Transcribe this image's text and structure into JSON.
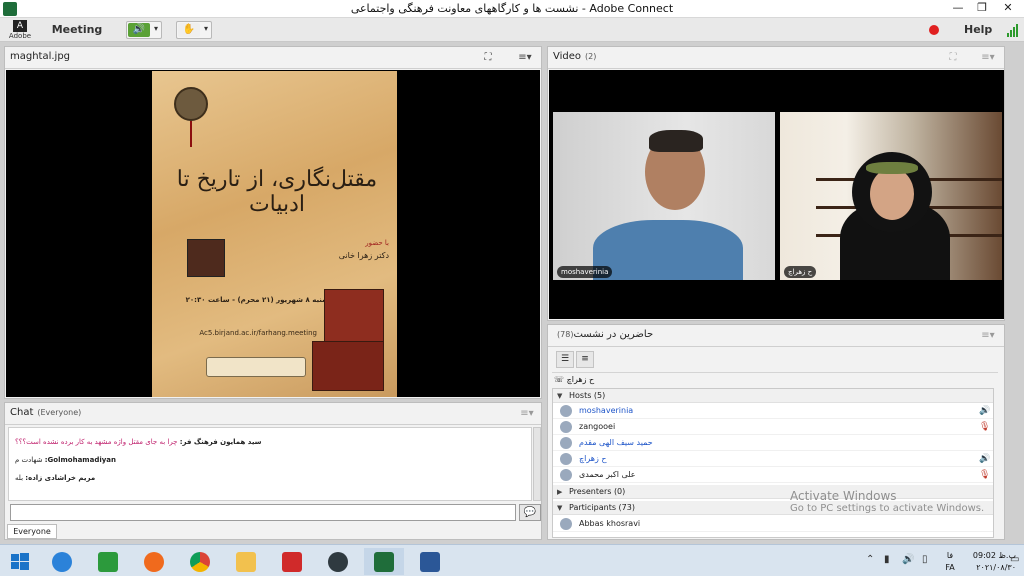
{
  "window": {
    "title": "نشست ها و کارگاههای معاونت فرهنگی واجتماعی - Adobe Connect",
    "minimize_glyph": "—",
    "restore_glyph": "❐",
    "close_glyph": "✕"
  },
  "menubar": {
    "adobe_label": "Adobe",
    "meeting_label": "Meeting",
    "help_label": "Help",
    "speaker_glyph": "🔊",
    "camera_glyph": "✋",
    "dropdown_glyph": "▾"
  },
  "share_pod": {
    "title": "maghtal.jpg",
    "fullscreen_glyph": "⛶",
    "menu_glyph": "≡▾",
    "poster": {
      "calligraphy": "مقتل‌نگاری، از تاریخ تا ادبیات",
      "presence_label": "با حضور",
      "speaker": "دکتر زهرا خانی",
      "date_line": "دوشنبه ۸ شهریور (۲۱ محرم) - ساعت ۲۰:۳۰",
      "url": "Ac5.birjand.ac.ir/farhang.meeting"
    }
  },
  "video_pod": {
    "title": "Video",
    "count": "(2)",
    "menu_glyph": "≡▾",
    "cams": [
      {
        "name": "moshaverinia"
      },
      {
        "name": "ح زهراچ"
      }
    ]
  },
  "chat_pod": {
    "title": "Chat",
    "audience": "(Everyone)",
    "menu_glyph": "≡▾",
    "messages": [
      {
        "sender": "سید همایون فرهنگ فر:",
        "text": "چرا به جای مقتل واژه مشهد به کار برده نشده است؟؟؟",
        "color": "#c0226e"
      },
      {
        "sender": "Golmohamadiyan:",
        "text": "شهادت م",
        "color": "#222222"
      },
      {
        "sender": "مریم خراشادی زاده:",
        "text": "بله",
        "color": "#222222"
      }
    ],
    "input_value": "",
    "send_glyph": "💬",
    "tab_label": "Everyone"
  },
  "attendee_pod": {
    "title": "حاضرین در نشست",
    "count": "(78)",
    "menu_glyph": "≡▾",
    "self_name": "ح زهراچ",
    "groups": [
      {
        "label": "Hosts (5)"
      },
      {
        "label": "Presenters (0)"
      },
      {
        "label": "Participants (73)"
      }
    ],
    "hosts": [
      {
        "name": "moshaverinia",
        "color": "#1f56c9",
        "mic": "🔊"
      },
      {
        "name": "zangooei",
        "color": "#222222",
        "mic": "🎙"
      },
      {
        "name": "حمید سیف الهی مقدم",
        "color": "#1f56c9",
        "mic": ""
      },
      {
        "name": "ح زهراچ",
        "color": "#1f56c9",
        "mic": "🔊"
      },
      {
        "name": "علی اکبر محمدی",
        "color": "#222222",
        "mic": "🎙"
      }
    ],
    "participants": [
      {
        "name": "Abbas khosravi"
      }
    ]
  },
  "activate": {
    "line1": "Activate Windows",
    "line2": "Go to PC settings to activate Windows."
  },
  "taskbar": {
    "clock_time": "09:02 ب.ظ",
    "clock_date": "۲۰۲۱/۰۸/۳۰",
    "lang_top": "فا",
    "lang_bottom": "FA"
  }
}
